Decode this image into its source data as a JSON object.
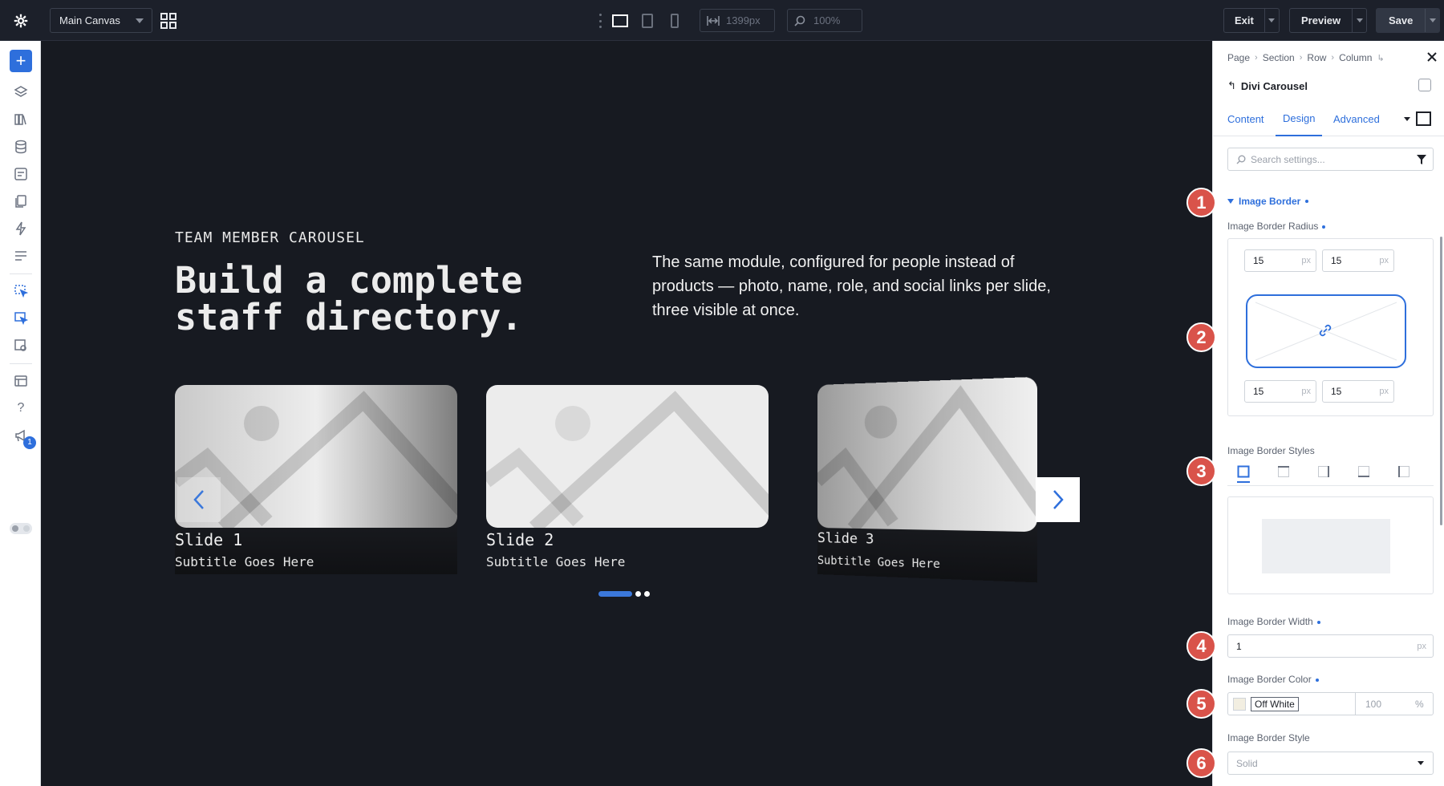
{
  "topbar": {
    "canvas_select": "Main Canvas",
    "width_value": "1399px",
    "zoom_value": "100%",
    "exit_label": "Exit",
    "preview_label": "Preview",
    "save_label": "Save"
  },
  "leftbar": {
    "notification_count": "1",
    "help_label": "?"
  },
  "canvas": {
    "kicker": "TEAM MEMBER CAROUSEL",
    "headline": "Build a complete staff directory.",
    "intro": "The same module, configured for people instead of products — photo, name, role, and social links per slide, three visible at once.",
    "slides": [
      {
        "title": "Slide 1",
        "subtitle": "Subtitle Goes Here"
      },
      {
        "title": "Slide 2",
        "subtitle": "Subtitle Goes Here"
      },
      {
        "title": "Slide 3",
        "subtitle": "Subtitle Goes Here"
      }
    ]
  },
  "panel": {
    "breadcrumbs": [
      "Page",
      "Section",
      "Row",
      "Column"
    ],
    "module_title": "Divi Carousel",
    "tabs": [
      "Content",
      "Design",
      "Advanced"
    ],
    "active_tab": "Design",
    "search_placeholder": "Search settings...",
    "section_title": "Image Border",
    "radius_label": "Image Border Radius",
    "radius": {
      "top_left": "15",
      "top_right": "15",
      "bottom_left": "15",
      "bottom_right": "15",
      "unit": "px"
    },
    "styles_label": "Image Border Styles",
    "width_label": "Image Border Width",
    "width_value": "1",
    "width_unit": "px",
    "color_label": "Image Border Color",
    "color_name": "Off White",
    "color_swatch": "#f2eee1",
    "opacity_value": "100",
    "opacity_unit": "%",
    "style_label": "Image Border Style",
    "style_value": "Solid"
  },
  "callouts": [
    "1",
    "2",
    "3",
    "4",
    "5",
    "6"
  ],
  "colors": {
    "accent": "#2e6fdc",
    "callout": "#d9534a",
    "canvas_bg": "#171a21"
  }
}
